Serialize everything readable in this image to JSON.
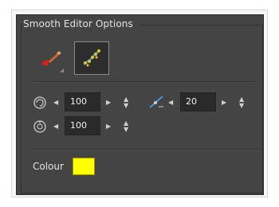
{
  "panel": {
    "title": "Smooth Editor Options"
  },
  "tools": [
    {
      "name": "brush-tool",
      "icon": "brush-icon"
    },
    {
      "name": "smooth-editor-tool",
      "icon": "smooth-editor-icon",
      "selected": true
    }
  ],
  "fields": {
    "smoothness": {
      "value": "100",
      "icon": "smoothness-icon"
    },
    "size": {
      "value": "20",
      "icon": "line-smoothing-icon"
    },
    "radius": {
      "value": "100",
      "icon": "radius-icon"
    }
  },
  "colour": {
    "label": "Colour",
    "value": "#ffff00"
  }
}
